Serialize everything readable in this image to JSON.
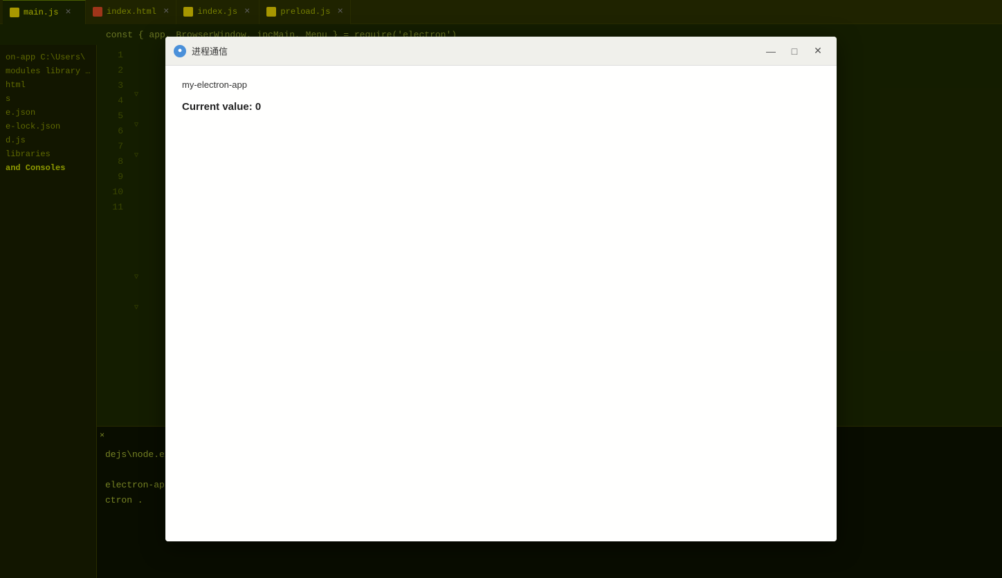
{
  "tabs": [
    {
      "label": "index.html",
      "type": "html",
      "active": false
    },
    {
      "label": "main.js",
      "type": "js-main",
      "active": true
    },
    {
      "label": "index.js",
      "type": "js-index",
      "active": false
    },
    {
      "label": "preload.js",
      "type": "js-preload",
      "active": false
    }
  ],
  "toolbar": {
    "icon1": "≡",
    "icon2": "⇄",
    "icon3": "⚙"
  },
  "sidebar": {
    "items": [
      {
        "label": "on-app",
        "prefix": "C:\\Users\\"
      },
      {
        "label": "modules",
        "prefix": "library roo"
      },
      {
        "label": "html"
      },
      {
        "label": "s"
      },
      {
        "label": "e.json"
      },
      {
        "label": "e-lock.json"
      },
      {
        "label": "d.js"
      },
      {
        "label": "libraries"
      },
      {
        "label": "and Consoles",
        "highlight": true
      }
    ]
  },
  "line_numbers": [
    1,
    2,
    3,
    4,
    5,
    6,
    7,
    8,
    9,
    10,
    11
  ],
  "top_code": "const { app, BrowserWindow, ipcMain, Menu } = require('electron')",
  "terminal": {
    "close_label": "×",
    "lines": [
      "",
      "dejs\\node.exe D",
      "",
      "electron-app@1.",
      "ctron ."
    ]
  },
  "dialog": {
    "title": "进程通信",
    "icon": "●",
    "subtitle": "my-electron-app",
    "current_value_label": "Current value:",
    "current_value": "0",
    "controls": {
      "minimize": "—",
      "maximize": "□",
      "close": "✕"
    }
  }
}
